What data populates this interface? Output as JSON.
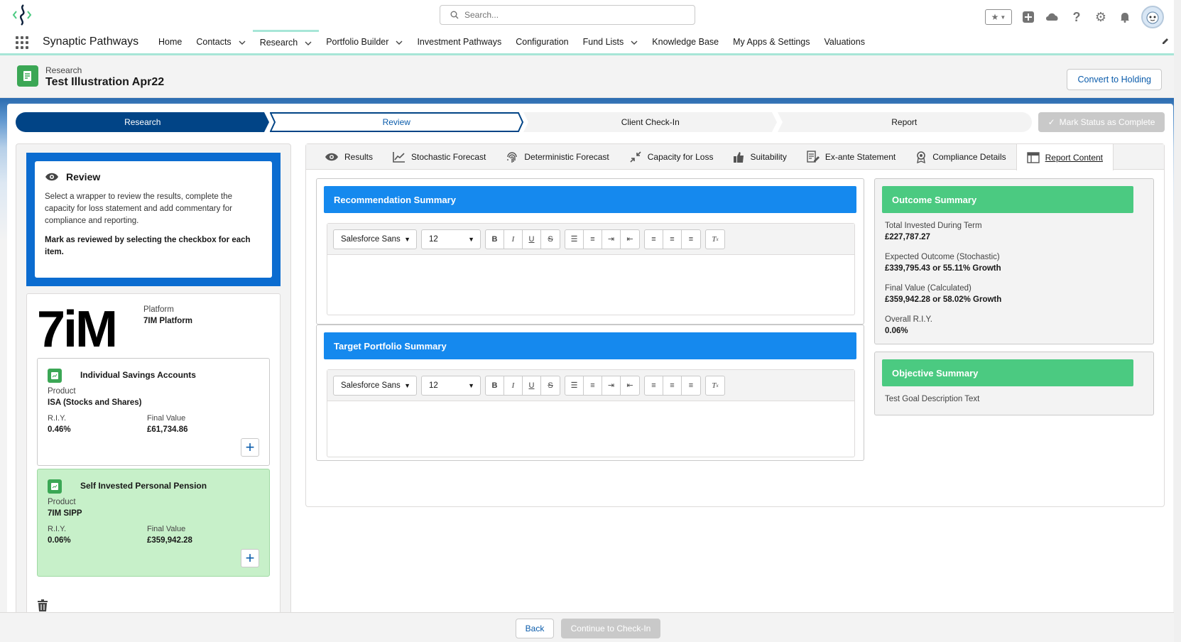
{
  "header": {
    "search_placeholder": "Search...",
    "app_name": "Synaptic Pathways"
  },
  "nav": {
    "items": [
      {
        "label": "Home",
        "dropdown": false
      },
      {
        "label": "Contacts",
        "dropdown": true
      },
      {
        "label": "Research",
        "dropdown": true,
        "active": true
      },
      {
        "label": "Portfolio Builder",
        "dropdown": true
      },
      {
        "label": "Investment Pathways",
        "dropdown": false
      },
      {
        "label": "Configuration",
        "dropdown": false
      },
      {
        "label": "Fund Lists",
        "dropdown": true
      },
      {
        "label": "Knowledge Base",
        "dropdown": false
      },
      {
        "label": "My Apps & Settings",
        "dropdown": false
      },
      {
        "label": "Valuations",
        "dropdown": false
      }
    ]
  },
  "page": {
    "object_label": "Research",
    "title": "Test Illustration Apr22",
    "convert_button": "Convert to Holding"
  },
  "path": {
    "steps": [
      "Research",
      "Review",
      "Client Check-In",
      "Report"
    ],
    "mark_button": "Mark Status as Complete"
  },
  "review": {
    "title": "Review",
    "text": "Select a wrapper to review the results, complete the capacity for loss statement and add commentary for compliance and reporting.",
    "bold_text": "Mark as reviewed by selecting the checkbox for each item."
  },
  "platform": {
    "logo_text": "7iM",
    "label": "Platform",
    "value": "7IM Platform"
  },
  "wrappers": [
    {
      "title": "Individual Savings Accounts",
      "product_label": "Product",
      "product": "ISA (Stocks and Shares)",
      "riy_label": "R.I.Y.",
      "riy": "0.46%",
      "final_label": "Final Value",
      "final_value": "£61,734.86",
      "add": "+"
    },
    {
      "title": "Self Invested Personal Pension",
      "product_label": "Product",
      "product": "7IM SIPP",
      "riy_label": "R.I.Y.",
      "riy": "0.06%",
      "final_label": "Final Value",
      "final_value": "£359,942.28",
      "add": "+"
    }
  ],
  "tabs": [
    {
      "label": "Results",
      "icon": "eye-icon"
    },
    {
      "label": "Stochastic Forecast",
      "icon": "line-chart-icon"
    },
    {
      "label": "Deterministic Forecast",
      "icon": "fingerprint-icon"
    },
    {
      "label": "Capacity for Loss",
      "icon": "collapse-arrows-icon"
    },
    {
      "label": "Suitability",
      "icon": "thumbs-up-icon"
    },
    {
      "label": "Ex-ante Statement",
      "icon": "document-edit-icon"
    },
    {
      "label": "Compliance Details",
      "icon": "badge-icon"
    },
    {
      "label": "Report Content",
      "icon": "table-icon",
      "active": true
    }
  ],
  "editors": {
    "recommendation_title": "Recommendation Summary",
    "target_title": "Target Portfolio Summary",
    "font_name": "Salesforce Sans",
    "font_size": "12"
  },
  "outcome": {
    "title": "Outcome Summary",
    "items": [
      {
        "label": "Total Invested During Term",
        "value": "£227,787.27"
      },
      {
        "label": "Expected Outcome (Stochastic)",
        "value": "£339,795.43 or 55.11% Growth"
      },
      {
        "label": "Final Value (Calculated)",
        "value": "£359,942.28 or 58.02% Growth"
      },
      {
        "label": "Overall R.I.Y.",
        "value": "0.06%"
      }
    ]
  },
  "objective": {
    "title": "Objective Summary",
    "text": "Test Goal Description Text"
  },
  "footer": {
    "back": "Back",
    "continue": "Continue to Check-In"
  },
  "colors": {
    "brand_blue": "#1589ee",
    "path_dark": "#014486",
    "success_green": "#4bca81",
    "selected_card": "#c7f0c9"
  }
}
